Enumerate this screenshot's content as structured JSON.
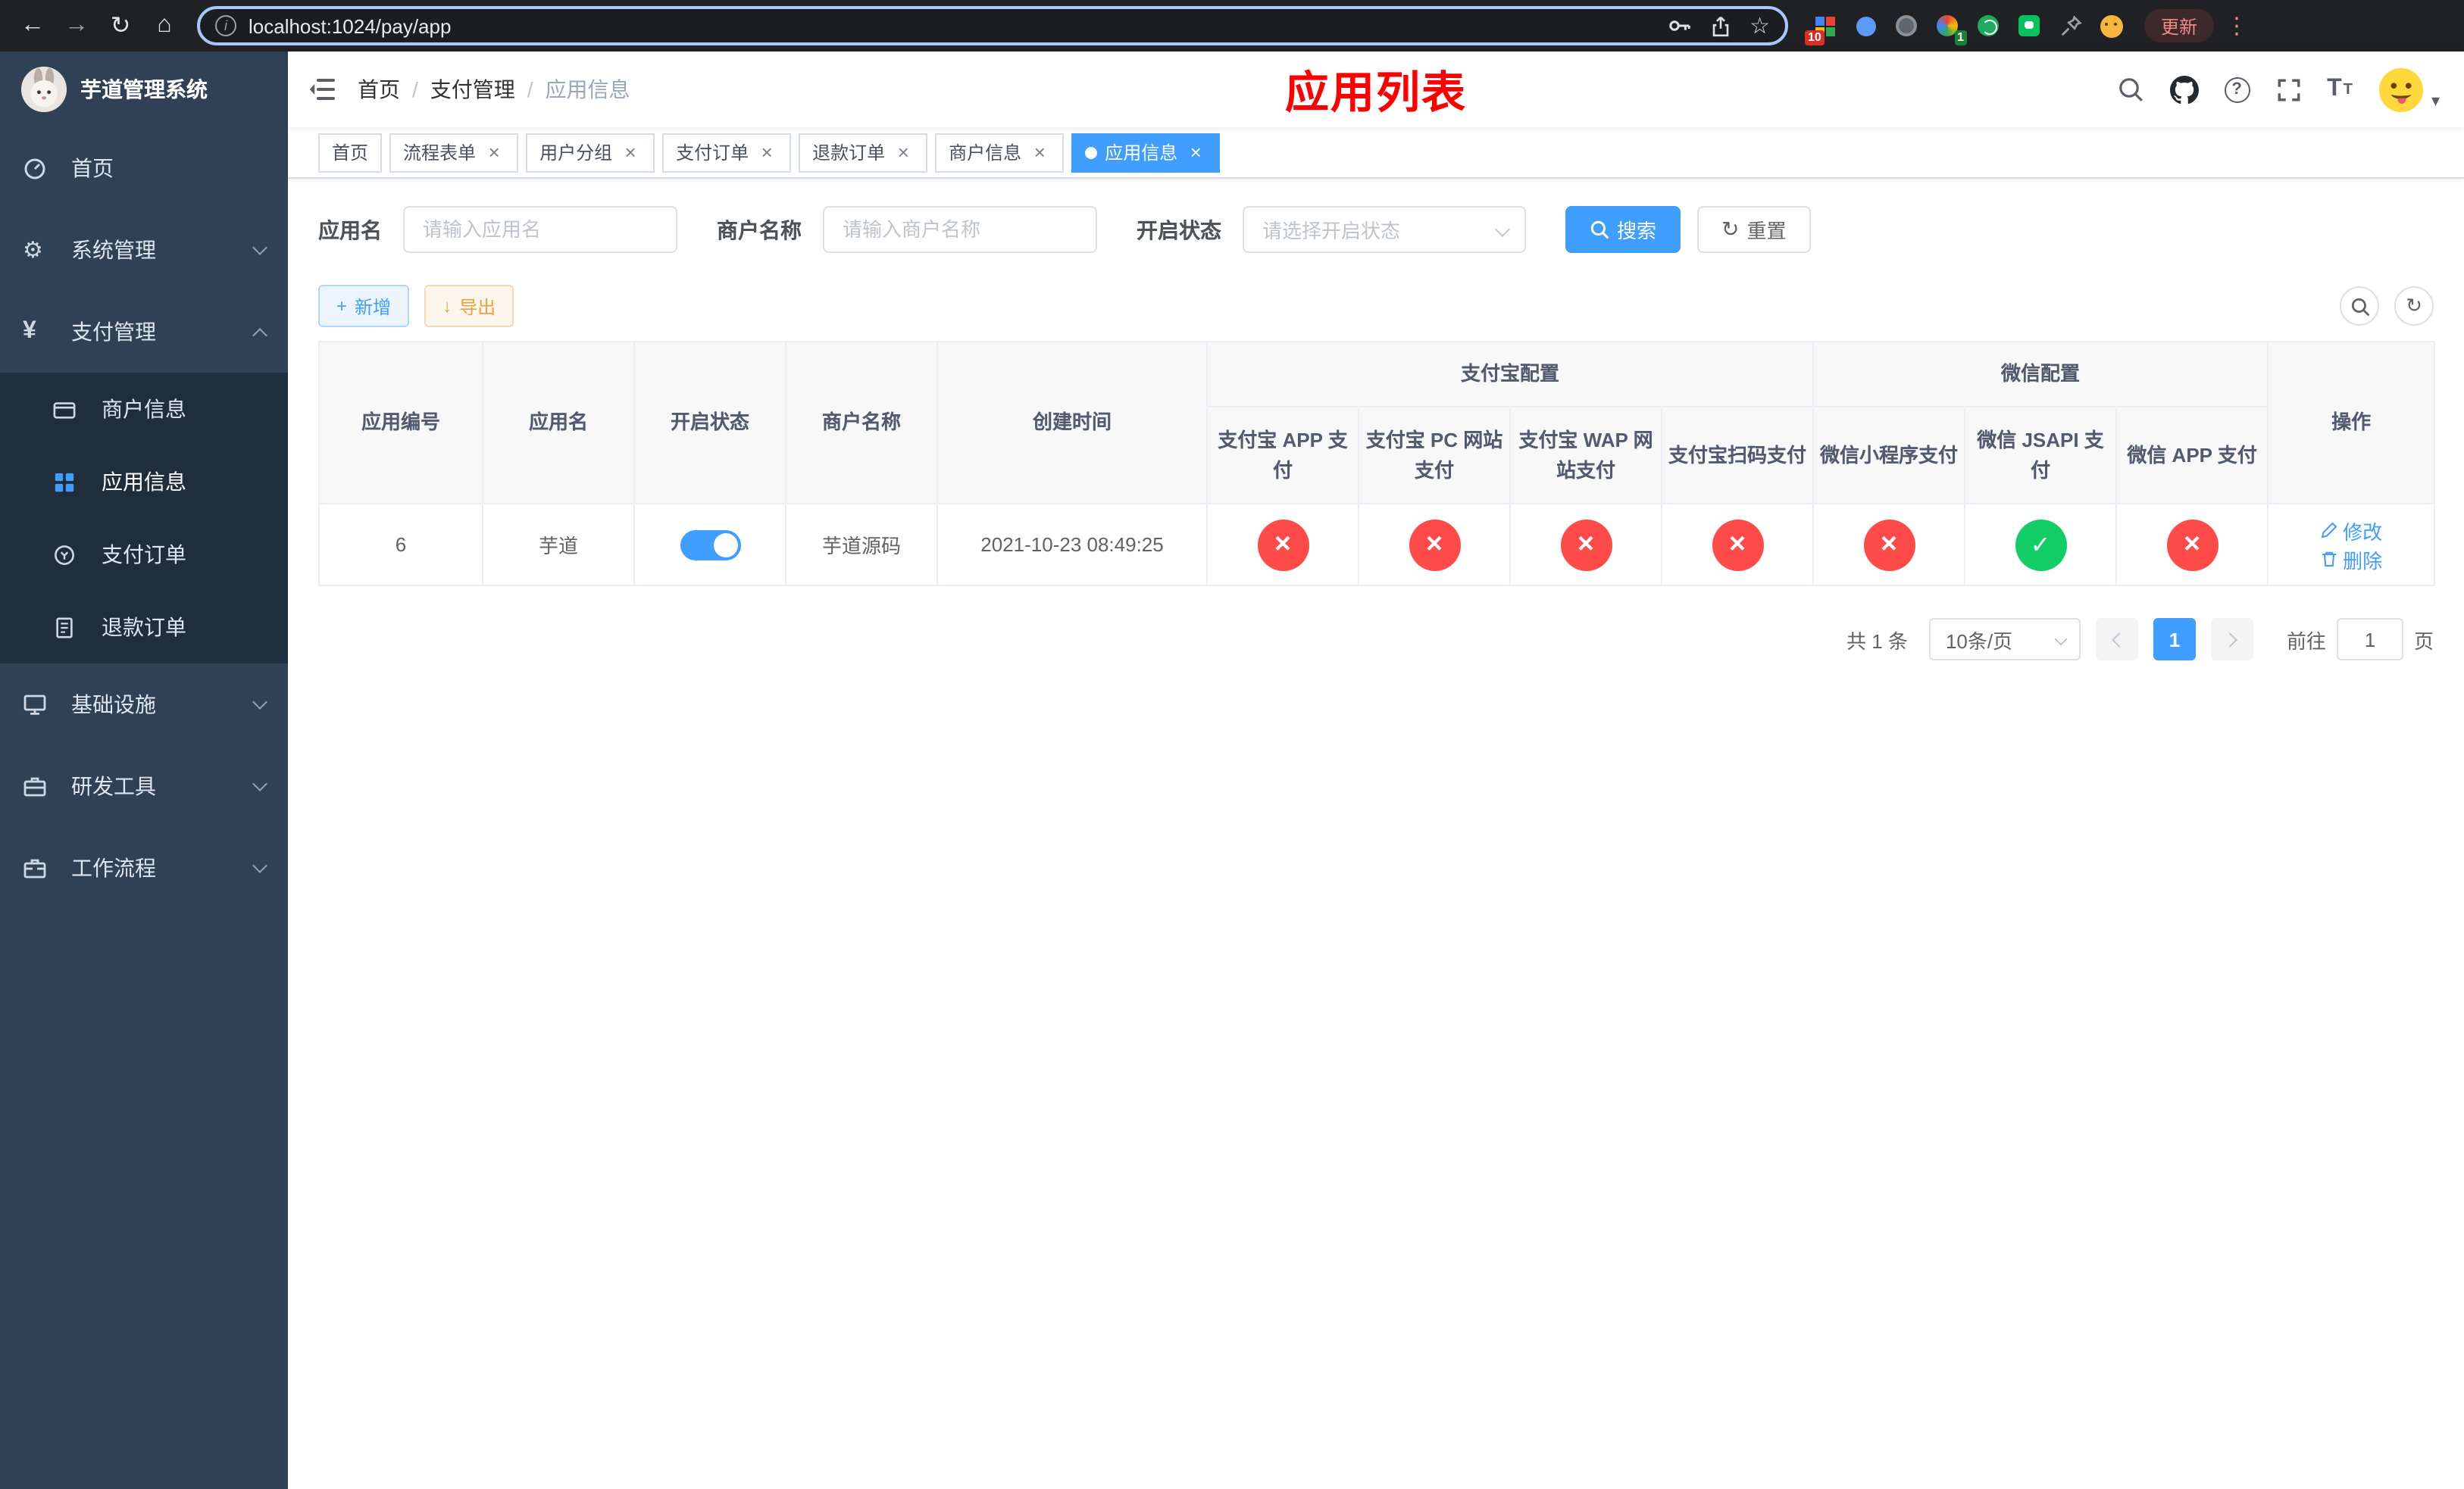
{
  "colors": {
    "accent": "#409EFF",
    "danger": "#FF4A4A",
    "success": "#13CE66",
    "page_title_red": "#FF0000",
    "sidebar_bg": "#304156",
    "submenu_bg": "#1F2D3D"
  },
  "browser": {
    "url": "localhost:1024/pay/app",
    "update_label": "更新",
    "extension_badge_1": "10",
    "extension_badge_2": "1"
  },
  "icons": {
    "back": "←",
    "forward": "→",
    "reload": "↻",
    "home": "⌂",
    "star": "☆",
    "dots": "⋮",
    "caret_down": "▾",
    "gear": "⚙",
    "yen": "¥",
    "plus": "+",
    "download": "↓"
  },
  "sidebar": {
    "title": "芋道管理系统",
    "menu": [
      {
        "label": "首页"
      },
      {
        "label": "系统管理"
      },
      {
        "label": "支付管理"
      },
      {
        "label": "基础设施"
      },
      {
        "label": "研发工具"
      },
      {
        "label": "工作流程"
      }
    ],
    "submenu": [
      {
        "label": "商户信息",
        "state": "normal"
      },
      {
        "label": "应用信息",
        "state": "active"
      },
      {
        "label": "支付订单",
        "state": "normal"
      },
      {
        "label": "退款订单",
        "state": "normal"
      }
    ]
  },
  "navbar": {
    "breadcrumb": [
      "首页",
      "支付管理",
      "应用信息"
    ],
    "page_title": "应用列表"
  },
  "tabs": [
    {
      "label": "首页",
      "state": "normal"
    },
    {
      "label": "流程表单",
      "state": "normal"
    },
    {
      "label": "用户分组",
      "state": "normal"
    },
    {
      "label": "支付订单",
      "state": "normal"
    },
    {
      "label": "退款订单",
      "state": "normal"
    },
    {
      "label": "商户信息",
      "state": "normal"
    },
    {
      "label": "应用信息",
      "state": "active"
    }
  ],
  "filter": {
    "app_name_label": "应用名",
    "app_name_placeholder": "请输入应用名",
    "merchant_label": "商户名称",
    "merchant_placeholder": "请输入商户名称",
    "status_label": "开启状态",
    "status_placeholder": "请选择开启状态",
    "search_label": "搜索",
    "reset_label": "重置"
  },
  "toolbar": {
    "add_label": "新增",
    "export_label": "导出"
  },
  "table": {
    "headers": {
      "app_id": "应用编号",
      "app_name": "应用名",
      "status": "开启状态",
      "merchant": "商户名称",
      "create_time": "创建时间",
      "alipay_group": "支付宝配置",
      "wechat_group": "微信配置",
      "actions": "操作",
      "channels": [
        "支付宝 APP 支付",
        "支付宝 PC 网站支付",
        "支付宝 WAP 网站支付",
        "支付宝扫码支付",
        "微信小程序支付",
        "微信 JSAPI 支付",
        "微信 APP 支付"
      ]
    },
    "rows": [
      {
        "app_id": "6",
        "app_name": "芋道",
        "status": "on",
        "merchant": "芋道源码",
        "create_time": "2021-10-23 08:49:25",
        "channels": [
          "disabled",
          "disabled",
          "disabled",
          "disabled",
          "disabled",
          "enabled",
          "disabled"
        ],
        "edit_label": "修改",
        "delete_label": "删除"
      }
    ]
  },
  "pagination": {
    "total_text": "共 1 条",
    "page_size_text": "10条/页",
    "current_page": "1",
    "goto_label": "前往",
    "goto_value": "1",
    "goto_unit": "页"
  }
}
